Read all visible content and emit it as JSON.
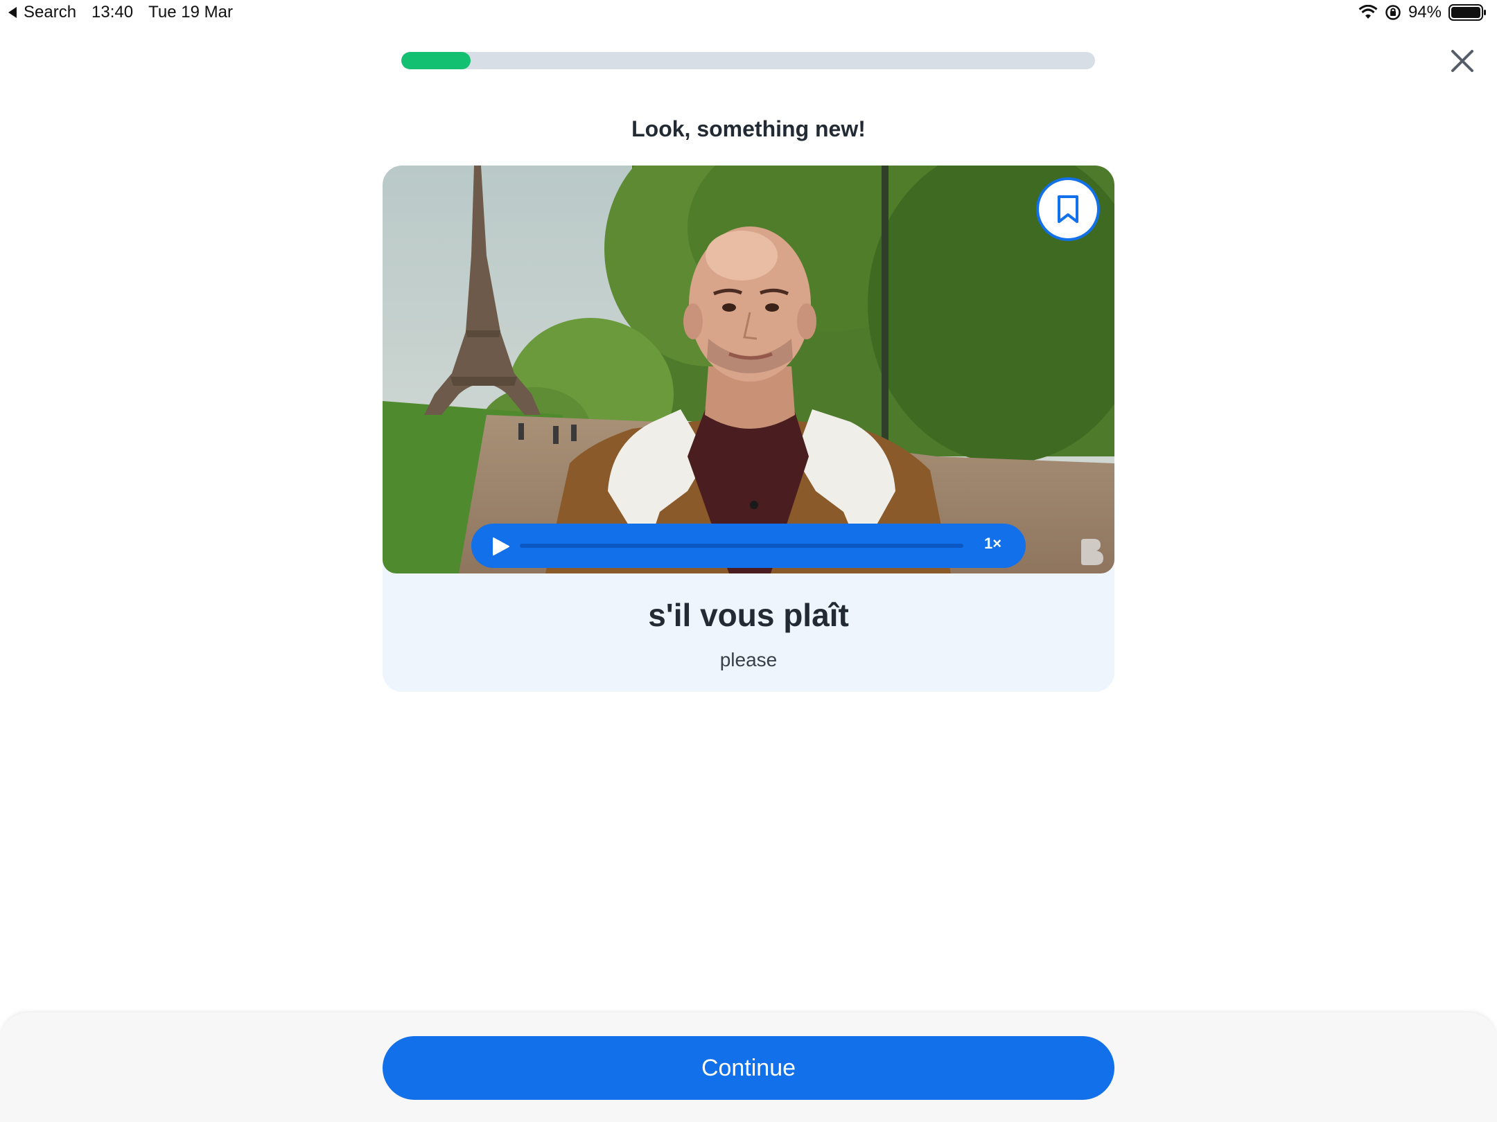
{
  "status_bar": {
    "back_label": "Search",
    "time": "13:40",
    "date": "Tue 19 Mar",
    "battery": "94%"
  },
  "lesson": {
    "progress_fraction": 0.1,
    "prompt": "Look, something new!"
  },
  "card": {
    "word": "s'il vous plaît",
    "translation": "please",
    "player": {
      "speed": "1×"
    }
  },
  "footer": {
    "continue_label": "Continue"
  },
  "colors": {
    "accent": "#1270EA",
    "progress": "#13BF70",
    "card_background": "#EFF5FC"
  }
}
